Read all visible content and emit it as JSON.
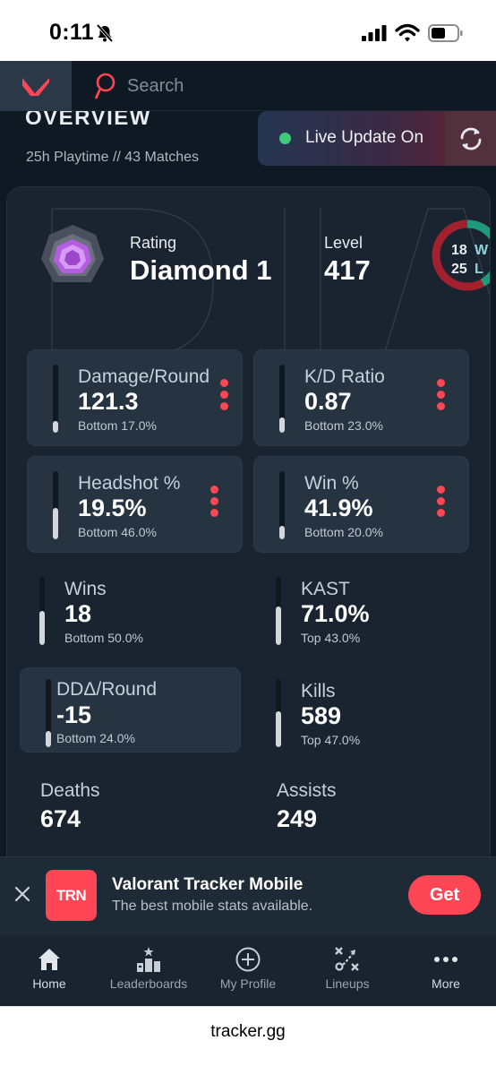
{
  "status_bar": {
    "time": "0:11"
  },
  "nav": {
    "search_placeholder": "Search"
  },
  "overview": {
    "title": "OVERVIEW",
    "summary": "25h Playtime  //  43 Matches"
  },
  "live_update": {
    "label": "Live Update On"
  },
  "profile": {
    "rating_label": "Rating",
    "rating_value": "Diamond 1",
    "level_label": "Level",
    "level_value": "417",
    "wins": "18",
    "wins_suffix": "W",
    "losses": "25",
    "losses_suffix": "L"
  },
  "stats": [
    {
      "label": "Damage/Round",
      "value": "121.3",
      "percentile": "Bottom 17.0%",
      "fill": 0.17
    },
    {
      "label": "K/D Ratio",
      "value": "0.87",
      "percentile": "Bottom 23.0%",
      "fill": 0.23
    },
    {
      "label": "Headshot %",
      "value": "19.5%",
      "percentile": "Bottom 46.0%",
      "fill": 0.46
    },
    {
      "label": "Win %",
      "value": "41.9%",
      "percentile": "Bottom 20.0%",
      "fill": 0.2
    },
    {
      "label": "Wins",
      "value": "18",
      "percentile": "Bottom 50.0%",
      "fill": 0.5
    },
    {
      "label": "KAST",
      "value": "71.0%",
      "percentile": "Top 43.0%",
      "fill": 0.57
    },
    {
      "label": "DDΔ/Round",
      "value": "-15",
      "percentile": "Bottom 24.0%",
      "fill": 0.24
    },
    {
      "label": "Kills",
      "value": "589",
      "percentile": "Top 47.0%",
      "fill": 0.53
    },
    {
      "label": "Deaths",
      "value": "674"
    },
    {
      "label": "Assists",
      "value": "249"
    }
  ],
  "ad": {
    "logo_text": "TRN",
    "title": "Valorant Tracker Mobile",
    "subtitle": "The best mobile stats available.",
    "cta": "Get"
  },
  "tabs": [
    {
      "label": "Home",
      "icon": "home-icon"
    },
    {
      "label": "Leaderboards",
      "icon": "leaderboards-icon"
    },
    {
      "label": "My Profile",
      "icon": "add-profile-icon"
    },
    {
      "label": "Lineups",
      "icon": "lineups-icon"
    },
    {
      "label": "More",
      "icon": "more-icon"
    }
  ],
  "browser": {
    "url": "tracker.gg"
  },
  "colors": {
    "accent_red": "#ff4655",
    "live_green": "#3ec97b",
    "background": "#0f1923",
    "card": "#1a2430",
    "win_ring": "#1f9a7a",
    "loss_ring": "#a3202f"
  }
}
